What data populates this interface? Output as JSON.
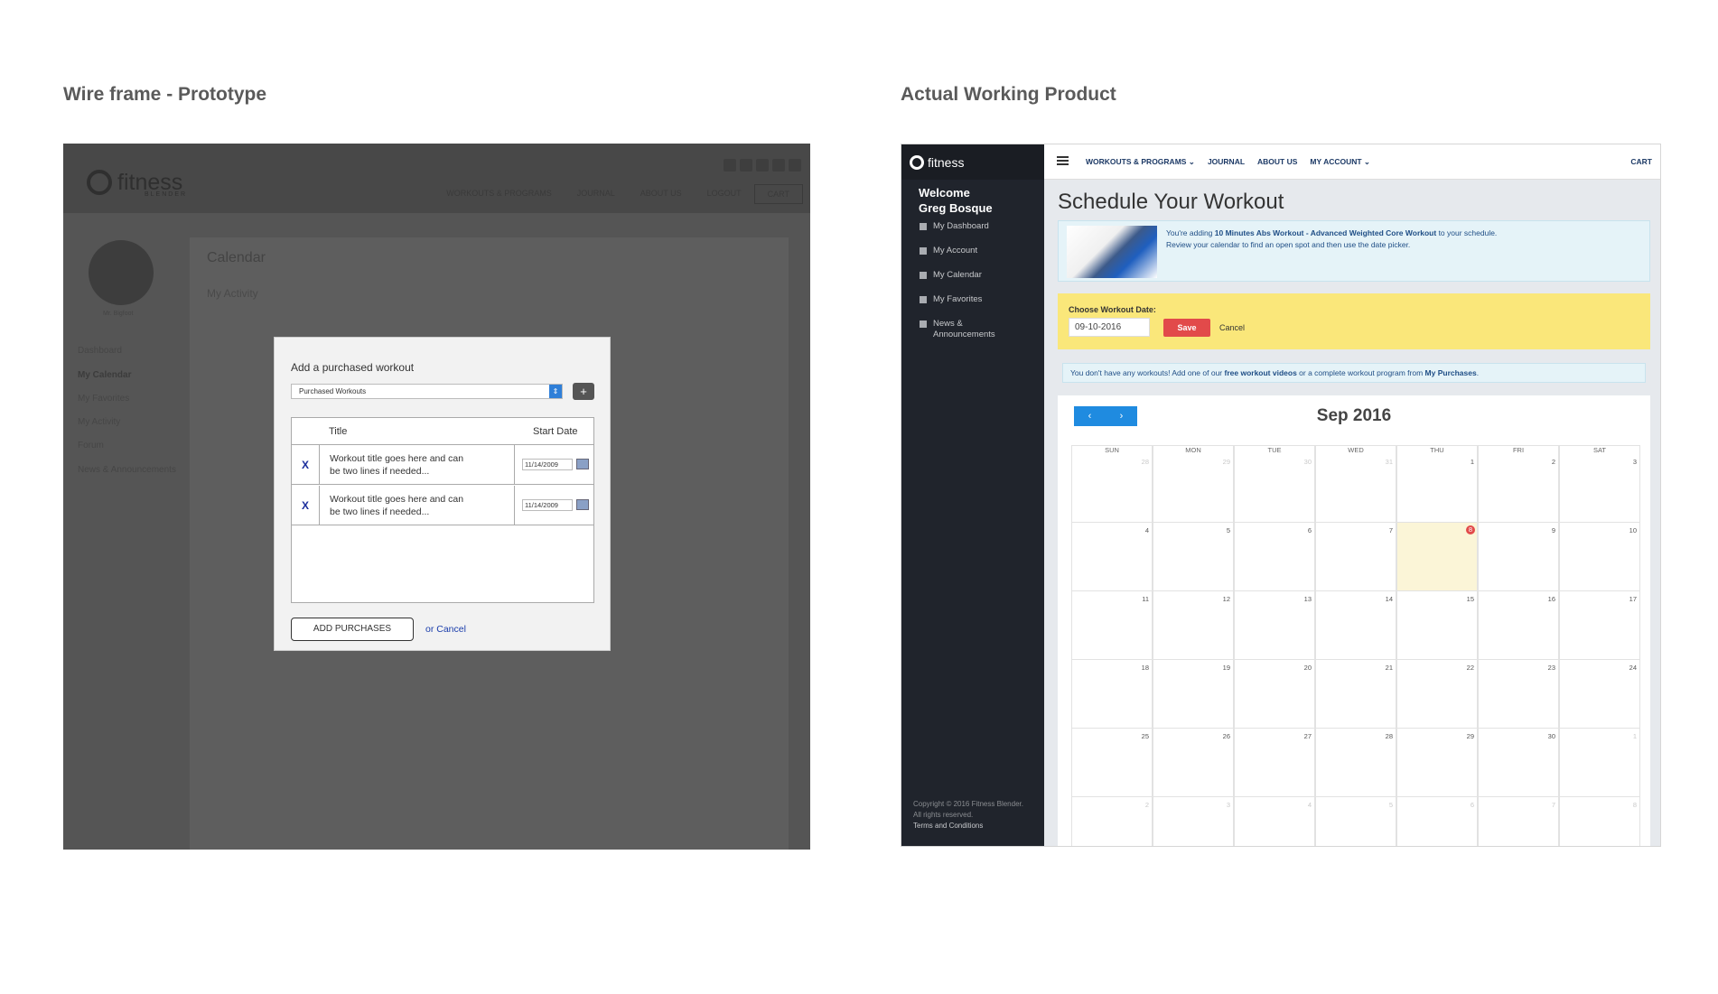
{
  "left_title": "Wire frame - Prototype",
  "right_title": "Actual Working Product",
  "wireframe": {
    "logo": "fitness",
    "logo_sub": "BLENDER",
    "nav": [
      "WORKOUTS & PROGRAMS",
      "JOURNAL",
      "ABOUT US",
      "LOGOUT",
      "CART"
    ],
    "avatar_name": "Mr. Bigfoot",
    "sidebar": [
      "Dashboard",
      "My Calendar",
      "My Favorites",
      "My Activity",
      "Forum",
      "News & Announcements"
    ],
    "calendar_title": "Calendar",
    "calendar_sub": "My Activity",
    "modal": {
      "title": "Add a purchased workout",
      "select_value": "Purchased Workouts",
      "add_icon": "+",
      "col_title": "Title",
      "col_date": "Start Date",
      "rows": [
        {
          "remove": "X",
          "title": "Workout title goes here and can be two lines if needed...",
          "date": "11/14/2009"
        },
        {
          "remove": "X",
          "title": "Workout title goes here and can be two lines if needed...",
          "date": "11/14/2009"
        }
      ],
      "add_button": "ADD PURCHASES",
      "cancel_link": "or Cancel"
    }
  },
  "product": {
    "logo": "fitness",
    "welcome": "Welcome",
    "user": "Greg Bosque",
    "sidebar": [
      "My Dashboard",
      "My Account",
      "My Calendar",
      "My Favorites",
      "News & Announcements"
    ],
    "footer_copyright": "Copyright © 2016 Fitness Blender.",
    "footer_rights": "All rights reserved.",
    "footer_terms": "Terms and Conditions",
    "nav": [
      "WORKOUTS & PROGRAMS ⌄",
      "JOURNAL",
      "ABOUT US",
      "MY ACCOUNT ⌄"
    ],
    "cart": "CART",
    "page_title": "Schedule Your Workout",
    "info_prefix": "You're adding ",
    "info_bold": "10 Minutes Abs Workout - Advanced Weighted Core Workout",
    "info_suffix": " to your schedule.",
    "info_line2": "Review your calendar to find an open spot and then use the date picker.",
    "date_label": "Choose Workout Date:",
    "date_value": "09-10-2016",
    "save": "Save",
    "cancel": "Cancel",
    "notice_prefix": "You don't have any workouts! Add one of our ",
    "notice_link1": "free workout videos",
    "notice_mid": " or a complete workout program from ",
    "notice_link2": "My Purchases",
    "notice_end": ".",
    "prev": "‹",
    "next": "›",
    "month": "Sep 2016",
    "dow": [
      "SUN",
      "MON",
      "TUE",
      "WED",
      "THU",
      "FRI",
      "SAT"
    ],
    "weeks": [
      [
        "28",
        "29",
        "30",
        "31",
        "1",
        "2",
        "3"
      ],
      [
        "4",
        "5",
        "6",
        "7",
        "8",
        "9",
        "10"
      ],
      [
        "11",
        "12",
        "13",
        "14",
        "15",
        "16",
        "17"
      ],
      [
        "18",
        "19",
        "20",
        "21",
        "22",
        "23",
        "24"
      ],
      [
        "25",
        "26",
        "27",
        "28",
        "29",
        "30",
        "1"
      ],
      [
        "2",
        "3",
        "4",
        "5",
        "6",
        "7",
        "8"
      ]
    ]
  }
}
